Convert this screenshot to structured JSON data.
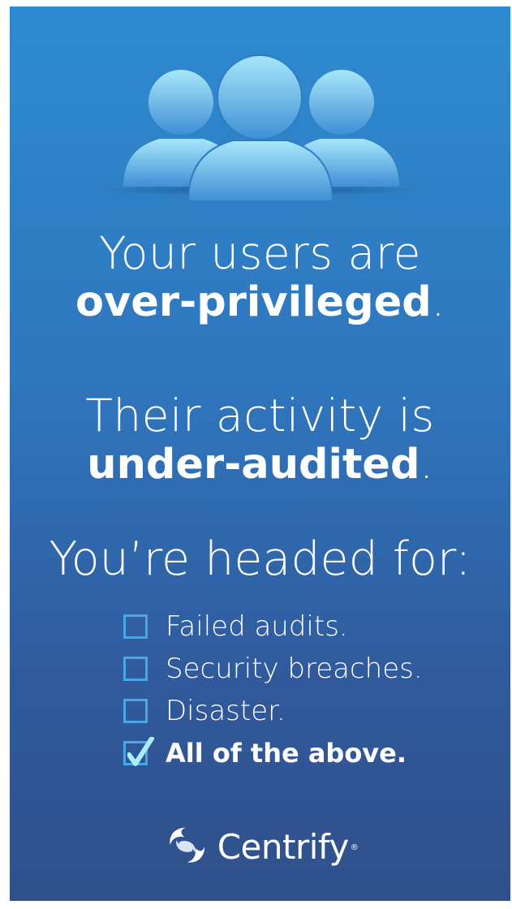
{
  "headline": {
    "line1": "Your users are",
    "line1_bold": "over-privileged",
    "line2": "Their activity is",
    "line2_bold": "under-audited",
    "period": ".",
    "line3": "You’re headed for:"
  },
  "options": [
    {
      "label": "Failed audits.",
      "checked": false
    },
    {
      "label": "Security breaches.",
      "checked": false
    },
    {
      "label": "Disaster.",
      "checked": false
    },
    {
      "label": "All of the above.",
      "checked": true
    }
  ],
  "brand": {
    "name": "Centrify",
    "registered": "®",
    "logo_icon": "centrify-swirl-icon",
    "hero_icon": "users-group-icon"
  },
  "colors": {
    "bg_top": "#2e8bd0",
    "bg_bottom": "#30508a",
    "checkbox": "#4aa6e6",
    "text": "#ffffff"
  }
}
